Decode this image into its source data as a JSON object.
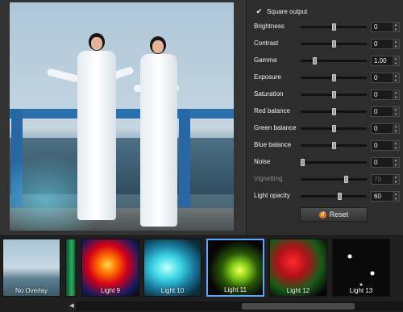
{
  "options": {
    "square_output_label": "Square output",
    "square_output_checked": true
  },
  "controls": [
    {
      "label": "Brightness",
      "value": "0",
      "level": 0.5,
      "enabled": true
    },
    {
      "label": "Contrast",
      "value": "0",
      "level": 0.5,
      "enabled": true
    },
    {
      "label": "Gamma",
      "value": "1.00",
      "level": 0.2,
      "enabled": true
    },
    {
      "label": "Exposure",
      "value": "0",
      "level": 0.5,
      "enabled": true
    },
    {
      "label": "Saturation",
      "value": "0",
      "level": 0.5,
      "enabled": true
    },
    {
      "label": "Red balance",
      "value": "0",
      "level": 0.5,
      "enabled": true
    },
    {
      "label": "Green balance",
      "value": "0",
      "level": 0.5,
      "enabled": true
    },
    {
      "label": "Blue balance",
      "value": "0",
      "level": 0.5,
      "enabled": true
    },
    {
      "label": "Noise",
      "value": "0",
      "level": 0.0,
      "enabled": true
    },
    {
      "label": "Vignetting",
      "value": "70",
      "level": 0.7,
      "enabled": false
    },
    {
      "label": "Light opacity",
      "value": "60",
      "level": 0.6,
      "enabled": true
    }
  ],
  "reset_label": "Reset",
  "overlays": [
    {
      "label": "No Overlay",
      "selected": false,
      "style": "photo"
    },
    {
      "label": "",
      "selected": false,
      "style": "partial"
    },
    {
      "label": "Light 9",
      "selected": false,
      "style": "light9"
    },
    {
      "label": "Light 10",
      "selected": false,
      "style": "light10"
    },
    {
      "label": "Light 11",
      "selected": true,
      "style": "light11"
    },
    {
      "label": "Light 12",
      "selected": false,
      "style": "light12"
    },
    {
      "label": "Light 13",
      "selected": false,
      "style": "light13"
    }
  ],
  "colors": {
    "accent": "#5ea8ff",
    "reset_icon": "#e07a1f",
    "panel_bg": "#2d2d2d"
  }
}
